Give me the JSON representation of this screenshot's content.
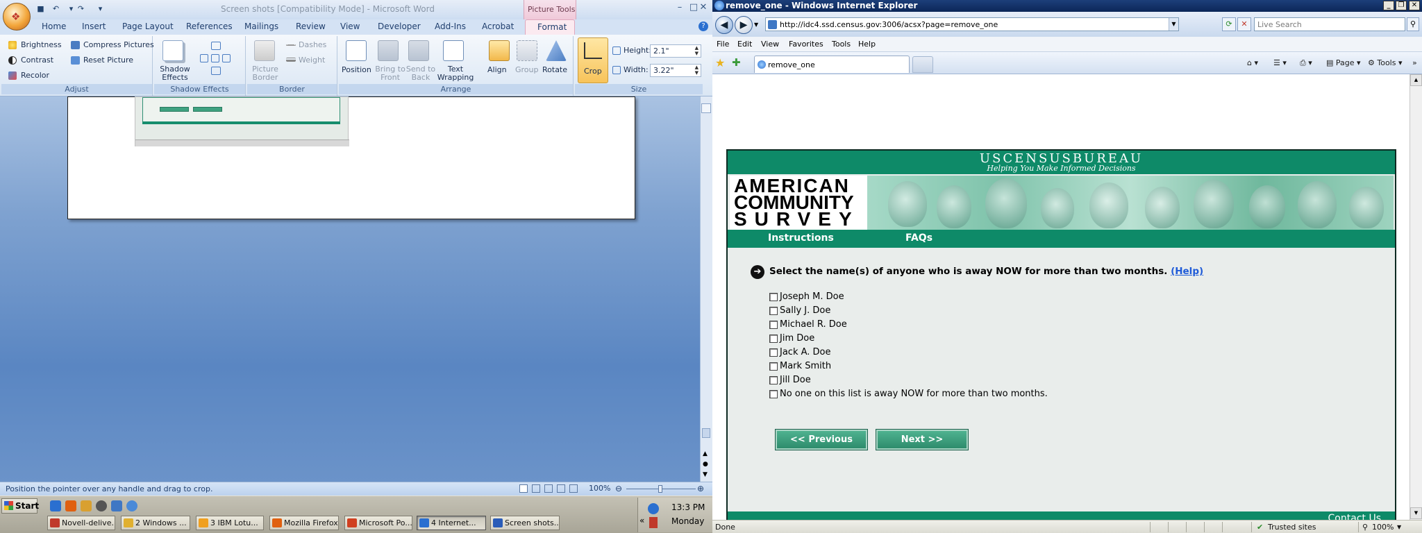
{
  "word": {
    "title": "Screen shots [Compatibility Mode] - Microsoft Word",
    "picture_tools_label": "Picture Tools",
    "tabs": [
      "Home",
      "Insert",
      "Page Layout",
      "References",
      "Mailings",
      "Review",
      "View",
      "Developer",
      "Add-Ins",
      "Acrobat"
    ],
    "active_tab": "Format",
    "ribbon": {
      "adjust": {
        "label": "Adjust",
        "brightness": "Brightness",
        "contrast": "Contrast",
        "recolor": "Recolor",
        "compress": "Compress Pictures",
        "reset": "Reset Picture"
      },
      "shadow": {
        "label": "Shadow Effects",
        "button": "Shadow Effects"
      },
      "border": {
        "label": "Border",
        "picture_border": "Picture Border",
        "dashes": "Dashes",
        "weight": "Weight"
      },
      "arrange": {
        "label": "Arrange",
        "position": "Position",
        "bring_to_front": "Bring to Front",
        "send_to_back": "Send to Back",
        "text_wrapping": "Text Wrapping",
        "align": "Align",
        "group": "Group",
        "rotate": "Rotate"
      },
      "size": {
        "label": "Size",
        "crop": "Crop",
        "height_label": "Height:",
        "height_value": "2.1\"",
        "width_label": "Width:",
        "width_value": "3.22\""
      }
    },
    "thumb": {
      "prev": "<< Previous",
      "next": "Next >>"
    },
    "status_message": "Position the pointer over any handle and drag to crop.",
    "zoom": "100%"
  },
  "taskbar": {
    "start": "Start",
    "tasks": [
      {
        "label": "Novell-delive...",
        "color": "#c0392b"
      },
      {
        "label": "2 Windows ...",
        "color": "#e0b030"
      },
      {
        "label": "3 IBM Lotu...",
        "color": "#f0a020"
      },
      {
        "label": "Mozilla Firefox",
        "color": "#e06010"
      },
      {
        "label": "Microsoft Po...",
        "color": "#d04020"
      },
      {
        "label": "4 Internet...",
        "color": "#2a6fd0"
      },
      {
        "label": "Screen shots...",
        "color": "#2a5cb8"
      }
    ],
    "time": "13:3 PM",
    "day": "Monday"
  },
  "ie": {
    "title": "remove_one - Windows Internet Explorer",
    "url": "http://idc4.ssd.census.gov:3006/acsx?page=remove_one",
    "search_placeholder": "Live Search",
    "menu": [
      "File",
      "Edit",
      "View",
      "Favorites",
      "Tools",
      "Help"
    ],
    "tab_label": "remove_one",
    "cmd": {
      "page": "Page",
      "tools": "Tools"
    },
    "status": {
      "left": "Done",
      "zone": "Trusted sites",
      "zoom": "100%"
    }
  },
  "census": {
    "bureau": "USCENSUSBUREAU",
    "tagline": "Helping You Make Informed Decisions",
    "acs_lines": [
      "AMERICAN",
      "COMMUNITY",
      "SURVEY"
    ],
    "nav": {
      "instructions": "Instructions",
      "faqs": "FAQs"
    },
    "question": "Select the name(s) of anyone who is away NOW for more than two months.",
    "help": "(Help)",
    "options": [
      "Joseph M. Doe",
      "Sally J. Doe",
      "Michael R. Doe",
      "Jim Doe",
      "Jack A. Doe",
      "Mark Smith",
      "Jill Doe",
      "No one on this list is away NOW for more than two months."
    ],
    "previous": "<<   Previous",
    "next": "Next   >>",
    "contact": "Contact Us",
    "accent": "#0e8a68"
  }
}
